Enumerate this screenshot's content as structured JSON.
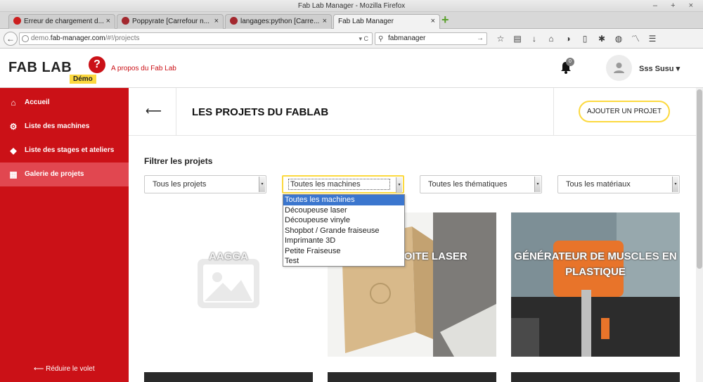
{
  "window": {
    "title": "Fab Lab Manager - Mozilla Firefox",
    "controls": "– + ×"
  },
  "tabs": [
    {
      "label": "Erreur de chargement d...",
      "icon": "error-icon",
      "color": "#cc1f1f"
    },
    {
      "label": "Poppyrate [Carrefour n...",
      "icon": "favicon-icon",
      "color": "#a3282e"
    },
    {
      "label": "langages:python [Carre...",
      "icon": "favicon-icon",
      "color": "#a3282e"
    },
    {
      "label": "Fab Lab Manager",
      "icon": "",
      "color": ""
    }
  ],
  "navbar": {
    "url_domain": "demo.fab-manager.com",
    "url_path": "/#!/projects",
    "search_value": "fabmanager"
  },
  "app": {
    "logo": "FAB LAB",
    "demo_badge": "Démo",
    "about_link": "A propos du Fab Lab",
    "notification_count": "0",
    "username": "Sss Susu ▾"
  },
  "sidebar": {
    "items": [
      {
        "label": "Accueil",
        "icon": "home-icon"
      },
      {
        "label": "Liste des machines",
        "icon": "gears-icon"
      },
      {
        "label": "Liste des stages et ateliers",
        "icon": "tags-icon"
      },
      {
        "label": "Galerie de projets",
        "icon": "grid-icon"
      }
    ],
    "collapse_label": "Réduire le volet"
  },
  "page": {
    "title": "LES PROJETS DU FABLAB",
    "add_button": "AJOUTER UN PROJET",
    "filter_title": "Filtrer les projets"
  },
  "filters": {
    "projects": "Tous les projets",
    "machines": "Toutes les machines",
    "themes": "Toutes les thématiques",
    "materials": "Tous les matériaux"
  },
  "machine_options": [
    "Toutes les machines",
    "Découpeuse laser",
    "Découpeuse vinyle",
    "Shopbot / Grande fraiseuse",
    "Imprimante 3D",
    "Petite Fraiseuse",
    "Test"
  ],
  "projects": [
    {
      "title": "AAGGA"
    },
    {
      "title": "PETITE BOITE LASER"
    },
    {
      "title": "GÉNÉRATEUR DE MUSCLES EN PLASTIQUE"
    }
  ],
  "colors": {
    "brand_red": "#cb1117",
    "accent_yellow": "#fcd93f",
    "active_item": "#e14750"
  }
}
